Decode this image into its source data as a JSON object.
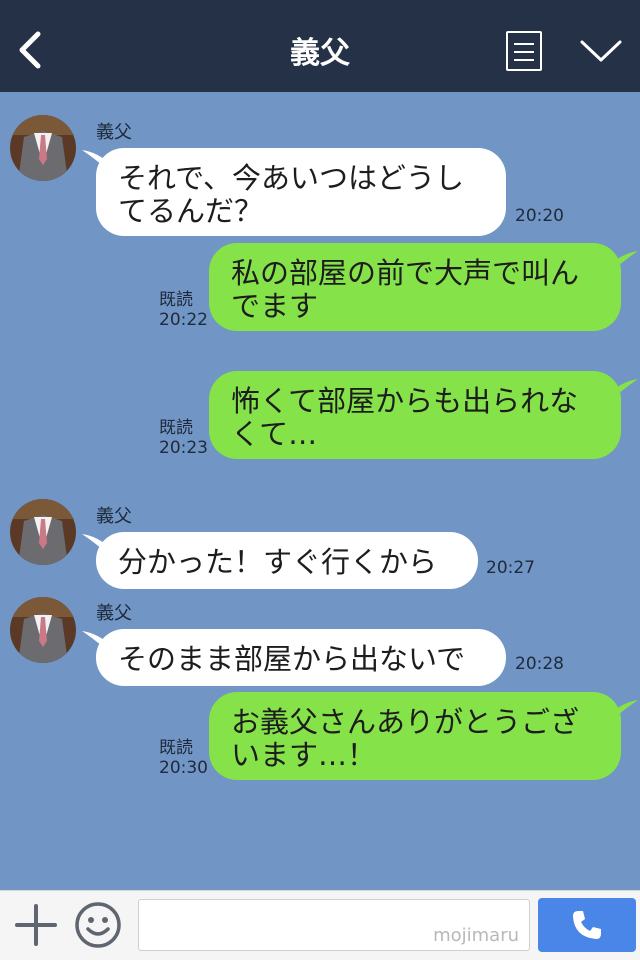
{
  "header": {
    "title": "義父",
    "back_icon": "chevron-left-icon",
    "menu_icon": "menu-icon",
    "collapse_icon": "chevron-down-icon"
  },
  "messages": [
    {
      "sender": "義父",
      "direction": "in",
      "lines": [
        "それで、今あいつはどうし",
        "てるんだ？"
      ],
      "time": "20:20"
    },
    {
      "direction": "out",
      "read": "既読",
      "lines": [
        "私の部屋の前で大声で叫ん",
        "でます"
      ],
      "time": "20:22"
    },
    {
      "direction": "out",
      "read": "既読",
      "lines": [
        "怖くて部屋からも出られな",
        "くて…"
      ],
      "time": "20:23"
    },
    {
      "sender": "義父",
      "direction": "in",
      "lines": [
        "分かった！すぐ行くから"
      ],
      "time": "20:27"
    },
    {
      "sender": "義父",
      "direction": "in",
      "lines": [
        "そのまま部屋から出ないで"
      ],
      "time": "20:28"
    },
    {
      "direction": "out",
      "read": "既読",
      "lines": [
        "お義父さんありがとうござ",
        "います…！"
      ],
      "time": "20:30"
    }
  ],
  "footer": {
    "plus_icon": "plus-icon",
    "emoji_icon": "smiley-icon",
    "input_value": "",
    "watermark": "mojimaru",
    "call_icon": "phone-icon"
  },
  "colors": {
    "header_bg": "#253147",
    "chat_bg": "#7195c4",
    "incoming_bubble": "#ffffff",
    "outgoing_bubble": "#85e249",
    "call_button": "#4a86e8"
  }
}
